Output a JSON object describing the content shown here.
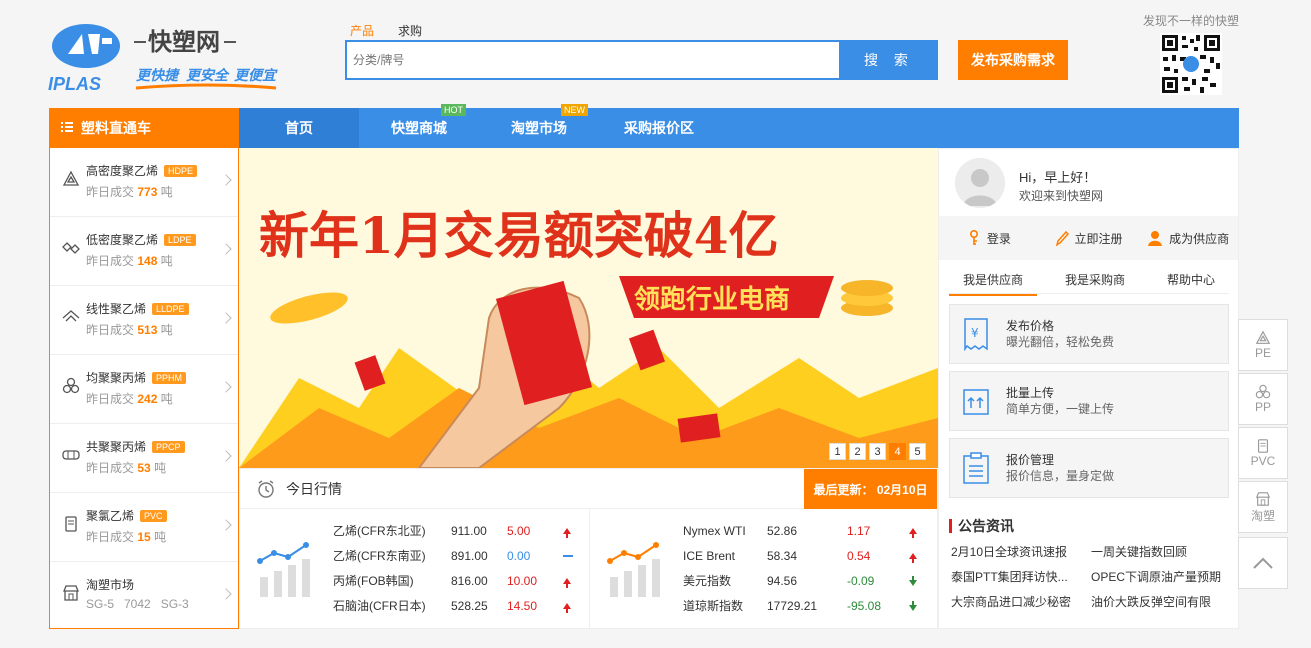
{
  "header": {
    "logo_cn": "快塑网",
    "logo_en": "IPLAS",
    "slogan": [
      "更快捷",
      "更安全",
      "更便宜"
    ],
    "search_tabs": [
      "产品",
      "求购"
    ],
    "search_placeholder": "分类/牌号",
    "search_button": "搜 索",
    "publish_button": "发布采购需求",
    "qr_caption": "发现不一样的快塑"
  },
  "nav": {
    "category_title": "塑料直通车",
    "items": [
      {
        "label": "首页",
        "badge": ""
      },
      {
        "label": "快塑商城",
        "badge": "HOT"
      },
      {
        "label": "淘塑市场",
        "badge": "NEW"
      },
      {
        "label": "采购报价区",
        "badge": ""
      }
    ]
  },
  "sidebar": {
    "items": [
      {
        "name": "高密度聚乙烯",
        "tag": "HDPE",
        "prefix": "昨日成交",
        "value": "773",
        "unit": "吨"
      },
      {
        "name": "低密度聚乙烯",
        "tag": "LDPE",
        "prefix": "昨日成交",
        "value": "148",
        "unit": "吨"
      },
      {
        "name": "线性聚乙烯",
        "tag": "LLDPE",
        "prefix": "昨日成交",
        "value": "513",
        "unit": "吨"
      },
      {
        "name": "均聚聚丙烯",
        "tag": "PPHM",
        "prefix": "昨日成交",
        "value": "242",
        "unit": "吨"
      },
      {
        "name": "共聚聚丙烯",
        "tag": "PPCP",
        "prefix": "昨日成交",
        "value": "53",
        "unit": "吨"
      },
      {
        "name": "聚氯乙烯",
        "tag": "PVC",
        "prefix": "昨日成交",
        "value": "15",
        "unit": "吨"
      }
    ],
    "market": {
      "name": "淘塑市场",
      "codes": "SG-5   7042   SG-3"
    }
  },
  "banner": {
    "headline": "新年1月交易额突破4亿",
    "ribbon": "领跑行业电商",
    "pages": [
      "1",
      "2",
      "3",
      "4",
      "5"
    ],
    "active_page": "4"
  },
  "market": {
    "title": "今日行情",
    "update": "最后更新：  02月10日",
    "left": [
      {
        "name": "乙烯(CFR东北亚)",
        "price": "911.00",
        "change": "5.00",
        "dir": "up"
      },
      {
        "name": "乙烯(CFR东南亚)",
        "price": "891.00",
        "change": "0.00",
        "dir": "flat"
      },
      {
        "name": "丙烯(FOB韩国)",
        "price": "816.00",
        "change": "10.00",
        "dir": "up"
      },
      {
        "name": "石脑油(CFR日本)",
        "price": "528.25",
        "change": "14.50",
        "dir": "up"
      }
    ],
    "right": [
      {
        "name": "Nymex WTI",
        "price": "52.86",
        "change": "1.17",
        "dir": "up"
      },
      {
        "name": "ICE Brent",
        "price": "58.34",
        "change": "0.54",
        "dir": "up"
      },
      {
        "name": "美元指数",
        "price": "94.56",
        "change": "-0.09",
        "dir": "down"
      },
      {
        "name": "道琼斯指数",
        "price": "17729.21",
        "change": "-95.08",
        "dir": "down"
      }
    ]
  },
  "user_panel": {
    "greeting": "Hi，早上好！",
    "welcome": "欢迎来到快塑网",
    "actions": [
      "登录",
      "立即注册",
      "成为供应商"
    ],
    "tabs": [
      "我是供应商",
      "我是采购商",
      "帮助中心"
    ],
    "cards": [
      {
        "title": "发布价格",
        "desc": "曝光翻倍，轻松免费"
      },
      {
        "title": "批量上传",
        "desc": "简单方便，一键上传"
      },
      {
        "title": "报价管理",
        "desc": "报价信息，量身定做"
      }
    ],
    "notice_title": "公告资讯",
    "notices": [
      "2月10日全球资讯速报",
      "一周关键指数回顾",
      "泰国PTT集团拜访快...",
      "OPEC下调原油产量预期",
      "大宗商品进口减少秘密",
      "油价大跌反弹空间有限"
    ]
  },
  "float_bar": [
    "PE",
    "PP",
    "PVC",
    "淘塑"
  ],
  "colors": {
    "brand_orange": "#ff7e00",
    "brand_blue": "#3a8ee6",
    "up": "#e02020",
    "down": "#2e8b3a"
  }
}
